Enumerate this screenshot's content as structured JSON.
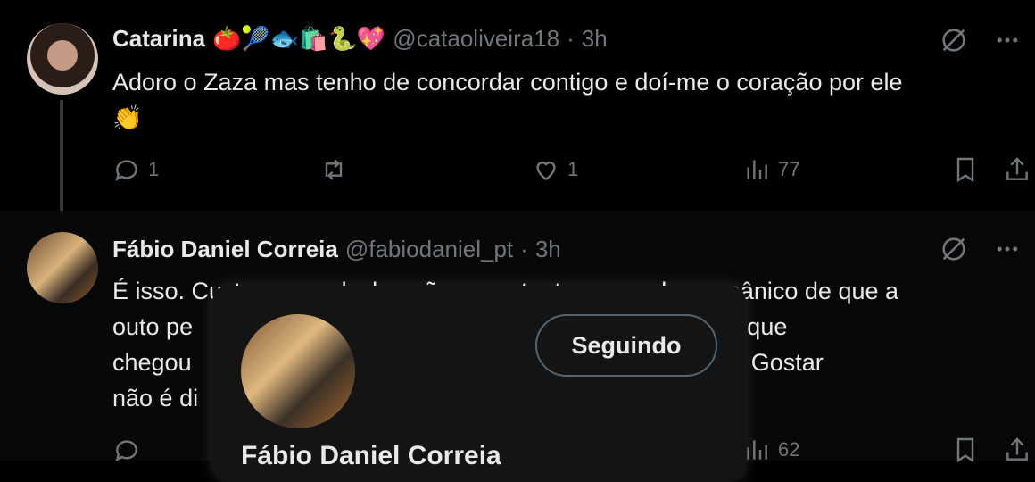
{
  "tweets": [
    {
      "name": "Catarina",
      "emojis": "🍅🎾🐟🛍️🐍💖",
      "handle": "@cataoliveira18",
      "dot": "·",
      "time": "3h",
      "text": "Adoro o Zaza mas tenho de concordar contigo e doí-me o coração por ele\n👏",
      "replies": "1",
      "likes": "1",
      "views": "77"
    },
    {
      "name": "Fábio Daniel Correia",
      "handle": "@fabiodaniel_pt",
      "dot": "·",
      "time": "3h",
      "text": "É isso. Custa ver as declarações constantes, o medo e o pânico de que a\nouto pe                                                          nde de alguém que\nchegou                                                              também isto. Gostar\nnão é di                                                          tu ",
      "views": "62"
    }
  ],
  "popup": {
    "follow_label": "Seguindo",
    "name": "Fábio Daniel Correia"
  },
  "icons": {
    "grok": "grok-icon",
    "more": "more-icon",
    "reply": "reply-icon",
    "retweet": "retweet-icon",
    "like": "heart-icon",
    "views": "views-icon",
    "bookmark": "bookmark-icon",
    "share": "share-icon"
  },
  "colors": {
    "background": "#000000",
    "text": "#e7e9ea",
    "muted": "#71767b",
    "heart": "#f91880"
  }
}
